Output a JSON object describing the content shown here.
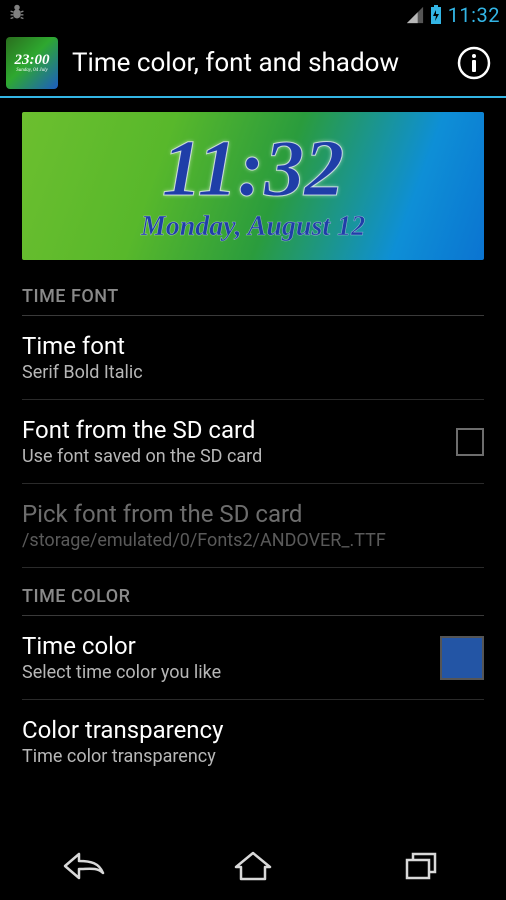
{
  "status_bar": {
    "clock": "11:32"
  },
  "action_bar": {
    "title": "Time color, font and shadow",
    "app_icon_time": "23:00",
    "app_icon_date": "Sunday, 04 July"
  },
  "preview": {
    "time": "11:32",
    "date": "Monday, August 12"
  },
  "sections": {
    "time_font": {
      "header": "TIME FONT",
      "font": {
        "title": "Time font",
        "summary": "Serif Bold Italic"
      },
      "from_sd": {
        "title": "Font from the SD card",
        "summary": "Use font saved on the SD card",
        "checked": false
      },
      "pick_sd": {
        "title": "Pick font from the SD card",
        "summary": "/storage/emulated/0/Fonts2/ANDOVER_.TTF",
        "enabled": false
      }
    },
    "time_color": {
      "header": "TIME COLOR",
      "color": {
        "title": "Time color",
        "summary": "Select time color you like",
        "value": "#2355a5"
      },
      "transparency": {
        "title": "Color transparency",
        "summary": "Time color transparency"
      }
    }
  }
}
